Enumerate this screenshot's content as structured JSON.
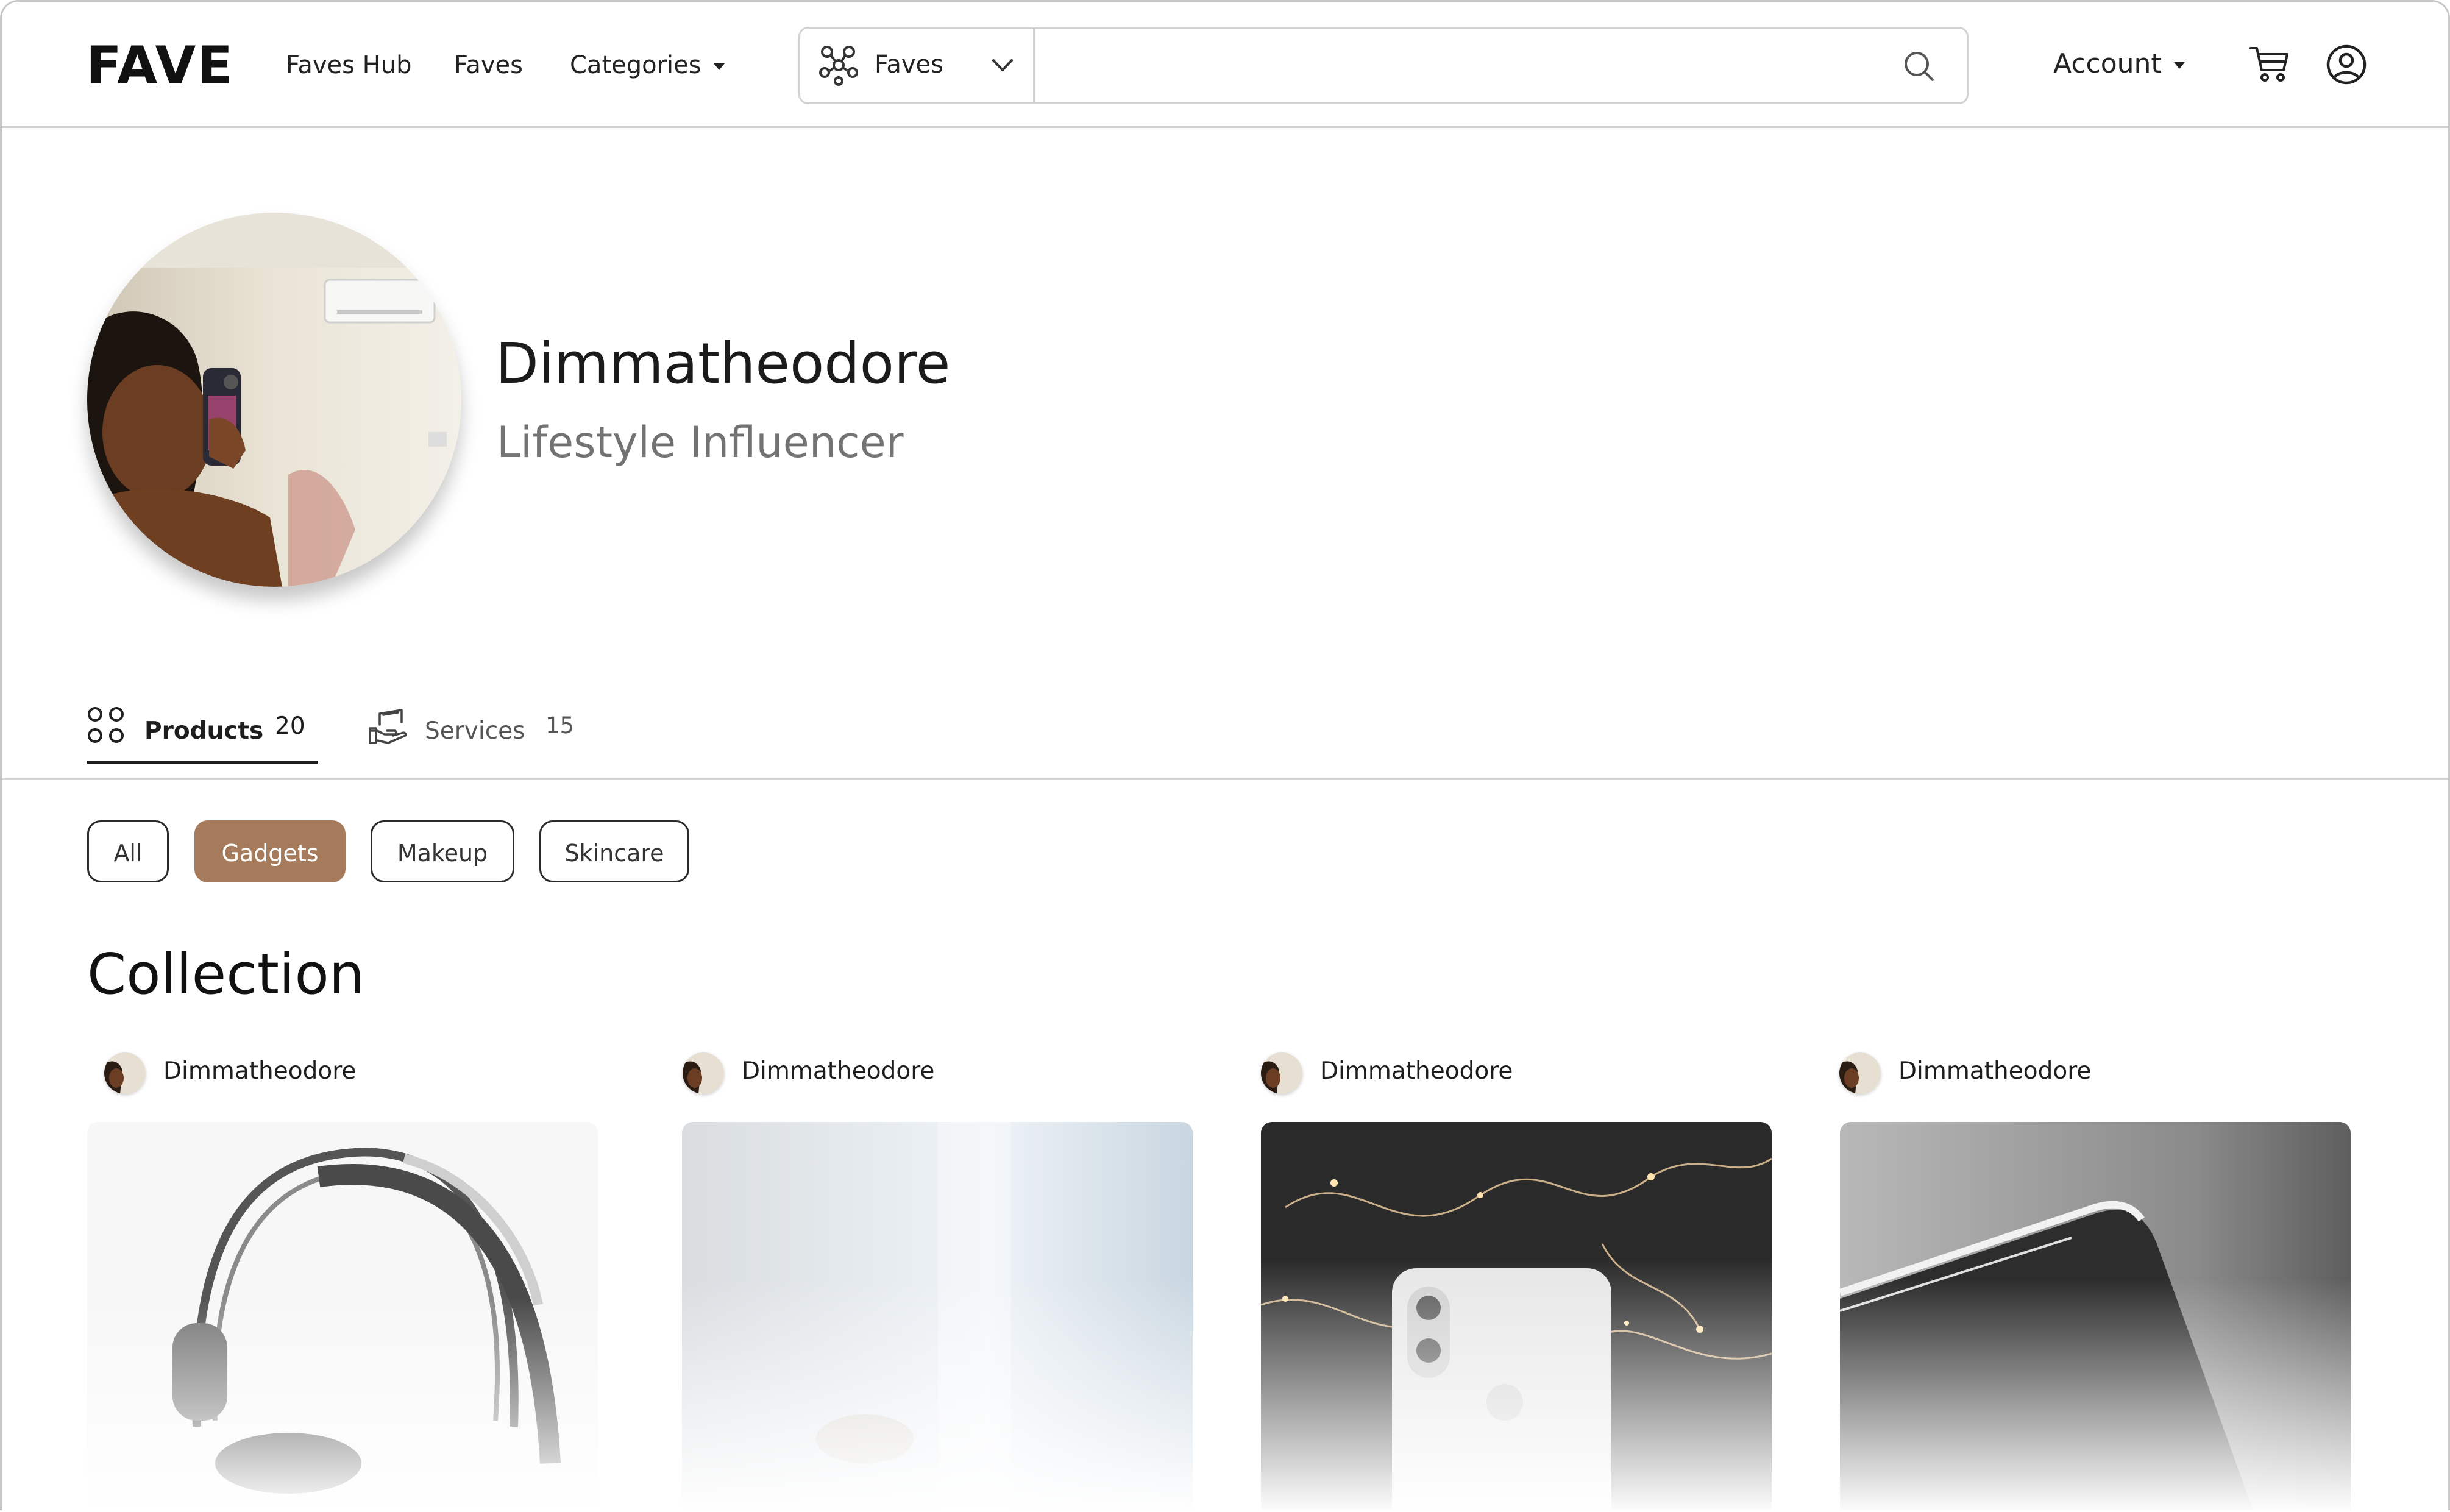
{
  "header": {
    "logo": "FAVE",
    "nav": [
      "Faves Hub",
      "Faves",
      "Categories"
    ],
    "search": {
      "scope": "Faves",
      "placeholder": ""
    },
    "account_label": "Account"
  },
  "profile": {
    "name": "Dimmatheodore",
    "title": "Lifestyle Influencer"
  },
  "tabs": [
    {
      "label": "Products",
      "count": "20",
      "active": true
    },
    {
      "label": "Services",
      "count": "15",
      "active": false
    }
  ],
  "filters": [
    {
      "label": "All",
      "active": false
    },
    {
      "label": "Gadgets",
      "active": true
    },
    {
      "label": "Makeup",
      "active": false
    },
    {
      "label": "Skincare",
      "active": false
    }
  ],
  "collection": {
    "heading": "Collection",
    "items": [
      {
        "author": "Dimmatheodore",
        "image": "headphones"
      },
      {
        "author": "Dimmatheodore",
        "image": "light-glass"
      },
      {
        "author": "Dimmatheodore",
        "image": "iphone-lights"
      },
      {
        "author": "Dimmatheodore",
        "image": "phone-edge"
      }
    ]
  },
  "colors": {
    "accent": "#a67b5b",
    "text": "#1d1d1d",
    "muted": "#707070",
    "border": "#cfcfcf"
  }
}
